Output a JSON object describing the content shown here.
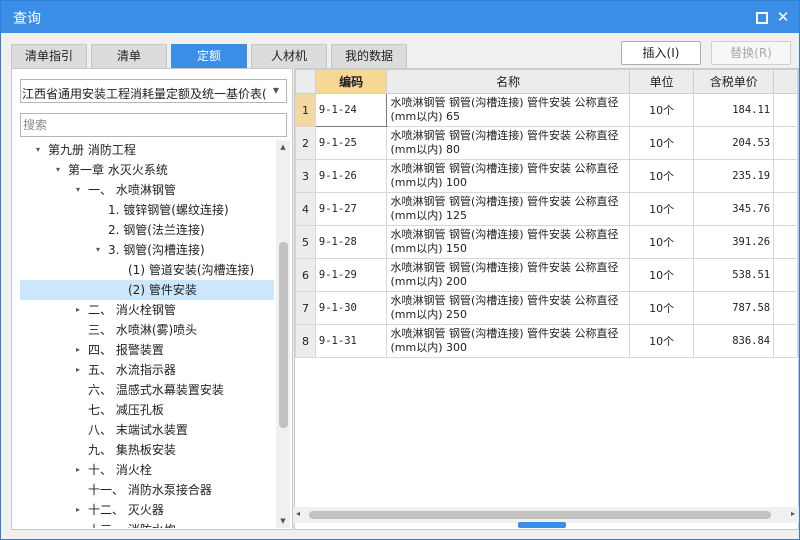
{
  "window": {
    "title": "查询"
  },
  "tabs": [
    {
      "label": "清单指引",
      "active": false
    },
    {
      "label": "清单",
      "active": false
    },
    {
      "label": "定额",
      "active": true
    },
    {
      "label": "人材机",
      "active": false
    },
    {
      "label": "我的数据",
      "active": false
    }
  ],
  "actions": {
    "insert_label": "插入(I)",
    "replace_label": "替换(R)"
  },
  "left": {
    "library_select": "江西省通用安装工程消耗量定额及统一基价表(",
    "search_placeholder": "搜索"
  },
  "tree": [
    {
      "label": "第九册 消防工程",
      "toggle": "▾",
      "level": 0
    },
    {
      "label": "第一章 水灭火系统",
      "toggle": "▾",
      "level": 1
    },
    {
      "label": "一、 水喷淋钢管",
      "toggle": "▾",
      "level": 2
    },
    {
      "label": "1. 镀锌钢管(螺纹连接)",
      "toggle": "",
      "level": 3
    },
    {
      "label": "2. 钢管(法兰连接)",
      "toggle": "",
      "level": 3
    },
    {
      "label": "3. 钢管(沟槽连接)",
      "toggle": "▾",
      "level": 3
    },
    {
      "label": "(1) 管道安装(沟槽连接)",
      "toggle": "",
      "level": 4
    },
    {
      "label": "(2) 管件安装",
      "toggle": "",
      "level": 4,
      "selected": true
    },
    {
      "label": "二、 消火栓钢管",
      "toggle": "▸",
      "level": 2
    },
    {
      "label": "三、 水喷淋(雾)喷头",
      "toggle": "",
      "level": 2
    },
    {
      "label": "四、 报警装置",
      "toggle": "▸",
      "level": 2
    },
    {
      "label": "五、 水流指示器",
      "toggle": "▸",
      "level": 2
    },
    {
      "label": "六、 温感式水幕装置安装",
      "toggle": "",
      "level": 2
    },
    {
      "label": "七、 减压孔板",
      "toggle": "",
      "level": 2
    },
    {
      "label": "八、 末端试水装置",
      "toggle": "",
      "level": 2
    },
    {
      "label": "九、 集热板安装",
      "toggle": "",
      "level": 2
    },
    {
      "label": "十、 消火栓",
      "toggle": "▸",
      "level": 2
    },
    {
      "label": "十一、 消防水泵接合器",
      "toggle": "",
      "level": 2
    },
    {
      "label": "十二、 灭火器",
      "toggle": "▸",
      "level": 2
    },
    {
      "label": "十三、 消防水炮",
      "toggle": "",
      "level": 2
    }
  ],
  "grid": {
    "columns": [
      "编码",
      "名称",
      "单位",
      "含税单价"
    ],
    "rows": [
      {
        "num": "1",
        "code": "9-1-24",
        "name": "水喷淋钢管 钢管(沟槽连接) 管件安装 公称直径(mm以内) 65",
        "unit": "10个",
        "price": "184.11"
      },
      {
        "num": "2",
        "code": "9-1-25",
        "name": "水喷淋钢管 钢管(沟槽连接) 管件安装 公称直径(mm以内) 80",
        "unit": "10个",
        "price": "204.53"
      },
      {
        "num": "3",
        "code": "9-1-26",
        "name": "水喷淋钢管 钢管(沟槽连接) 管件安装 公称直径(mm以内) 100",
        "unit": "10个",
        "price": "235.19"
      },
      {
        "num": "4",
        "code": "9-1-27",
        "name": "水喷淋钢管 钢管(沟槽连接) 管件安装 公称直径(mm以内) 125",
        "unit": "10个",
        "price": "345.76"
      },
      {
        "num": "5",
        "code": "9-1-28",
        "name": "水喷淋钢管 钢管(沟槽连接) 管件安装 公称直径(mm以内) 150",
        "unit": "10个",
        "price": "391.26"
      },
      {
        "num": "6",
        "code": "9-1-29",
        "name": "水喷淋钢管 钢管(沟槽连接) 管件安装 公称直径(mm以内) 200",
        "unit": "10个",
        "price": "538.51"
      },
      {
        "num": "7",
        "code": "9-1-30",
        "name": "水喷淋钢管 钢管(沟槽连接) 管件安装 公称直径(mm以内) 250",
        "unit": "10个",
        "price": "787.58"
      },
      {
        "num": "8",
        "code": "9-1-31",
        "name": "水喷淋钢管 钢管(沟槽连接) 管件安装 公称直径(mm以内) 300",
        "unit": "10个",
        "price": "836.84"
      }
    ]
  }
}
